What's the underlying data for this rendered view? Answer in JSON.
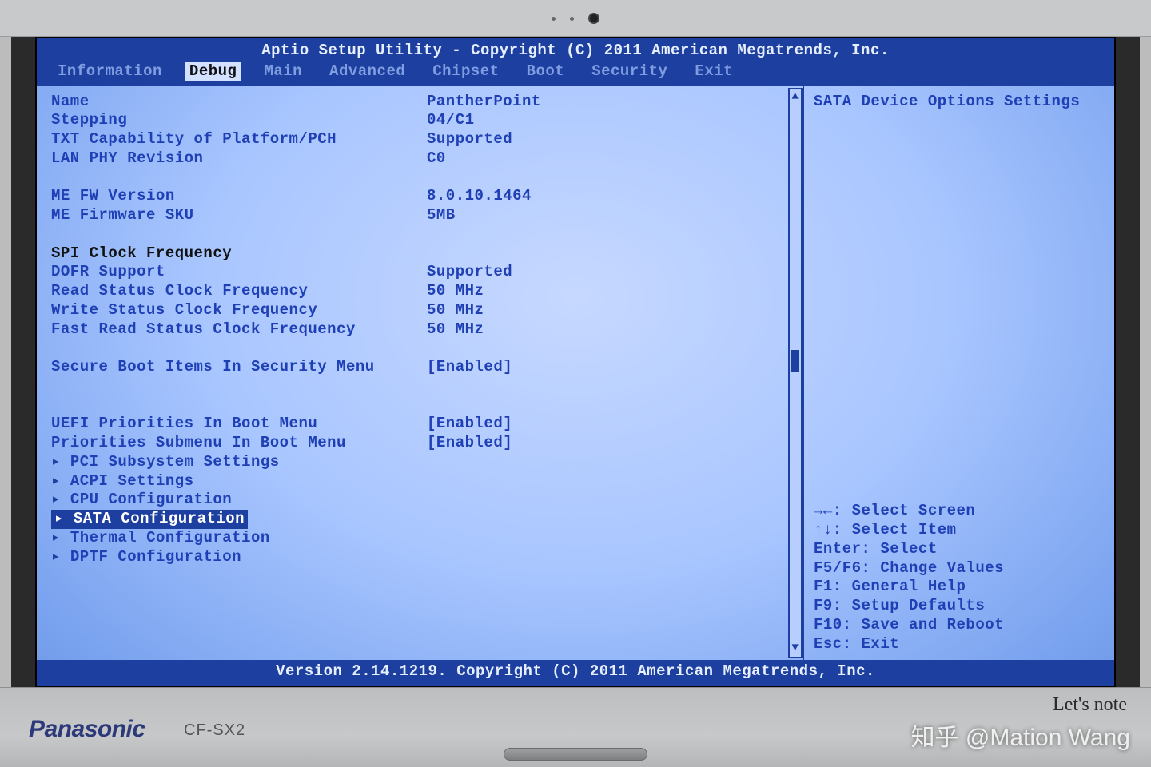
{
  "title": "Aptio Setup Utility - Copyright (C) 2011 American Megatrends, Inc.",
  "tabs": [
    "Information",
    "Debug",
    "Main",
    "Advanced",
    "Chipset",
    "Boot",
    "Security",
    "Exit"
  ],
  "active_tab": "Debug",
  "info_rows": [
    {
      "label": "Name",
      "value": "PantherPoint"
    },
    {
      "label": "Stepping",
      "value": "04/C1"
    },
    {
      "label": "TXT Capability of Platform/PCH",
      "value": "Supported"
    },
    {
      "label": "LAN PHY Revision",
      "value": "C0"
    }
  ],
  "me_rows": [
    {
      "label": "ME FW Version",
      "value": "8.0.10.1464"
    },
    {
      "label": "ME Firmware SKU",
      "value": "5MB"
    }
  ],
  "spi_heading": "SPI Clock Frequency",
  "spi_rows": [
    {
      "label": "DOFR Support",
      "value": "Supported"
    },
    {
      "label": "Read Status Clock Frequency",
      "value": "50 MHz"
    },
    {
      "label": "Write Status Clock Frequency",
      "value": "50 MHz"
    },
    {
      "label": "Fast Read Status Clock Frequency",
      "value": "50 MHz"
    }
  ],
  "secure_boot": {
    "label": "Secure Boot Items In Security Menu",
    "value": "[Enabled]"
  },
  "boot_rows": [
    {
      "label": "UEFI Priorities In Boot Menu",
      "value": "[Enabled]"
    },
    {
      "label": "Priorities Submenu In Boot Menu",
      "value": "[Enabled]"
    }
  ],
  "submenus": [
    "PCI Subsystem Settings",
    "ACPI Settings",
    "CPU Configuration",
    "SATA Configuration",
    "Thermal Configuration",
    "DPTF Configuration"
  ],
  "selected_submenu": "SATA Configuration",
  "help_text": "SATA Device Options Settings",
  "key_hints": [
    "→←: Select Screen",
    "↑↓: Select Item",
    "Enter: Select",
    "F5/F6: Change Values",
    "F1: General Help",
    "F9: Setup Defaults",
    "F10: Save and Reboot",
    "Esc: Exit"
  ],
  "footer": "Version 2.14.1219. Copyright (C) 2011 American Megatrends, Inc.",
  "brand": {
    "maker": "Panasonic",
    "model": "CF-SX2",
    "series": "Let's note"
  },
  "watermark": "知乎 @Mation Wang"
}
